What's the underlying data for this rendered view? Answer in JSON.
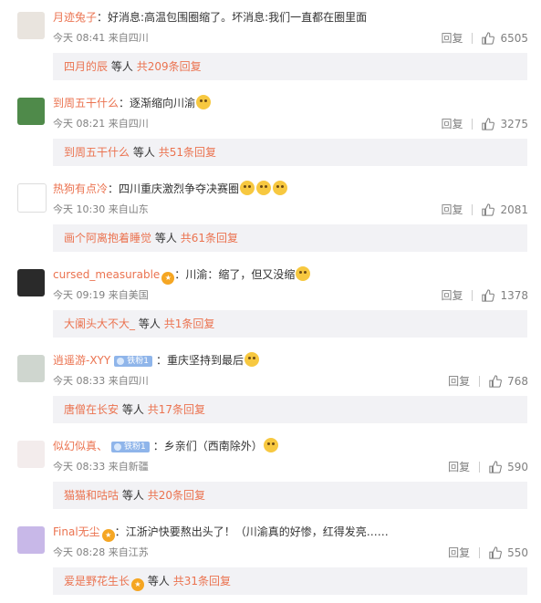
{
  "colors": {
    "username": "#eb7350",
    "link": "#eb7350",
    "meta": "#808080",
    "subbox_bg": "#f2f2f5",
    "badge": "#8fb5ea"
  },
  "labels": {
    "reply": "回复",
    "etc": "等人"
  },
  "comments": [
    {
      "username": "月迹兔子",
      "colon": "：",
      "text": "好消息:高温包围圈缩了。坏消息:我们一直都在圈里面",
      "emojis": [],
      "badge": "",
      "vip": false,
      "time": "今天 08:41",
      "location": "来自四川",
      "likes": "6505",
      "sub_user": "四月的辰",
      "sub_user_vip": false,
      "sub_count": "共209条回复"
    },
    {
      "username": "到周五干什么",
      "colon": "：",
      "text": "逐渐缩向川渝",
      "emojis": [
        "thinking-emoji"
      ],
      "badge": "",
      "vip": false,
      "time": "今天 08:21",
      "location": "来自四川",
      "likes": "3275",
      "sub_user": "到周五干什么",
      "sub_user_vip": false,
      "sub_count": "共51条回复"
    },
    {
      "username": "热狗有点冷",
      "colon": "：",
      "text": "四川重庆激烈争夺决赛圈",
      "emojis": [
        "laugh-cry-emoji",
        "laugh-cry-emoji",
        "laugh-cry-emoji"
      ],
      "badge": "",
      "vip": false,
      "time": "今天 10:30",
      "location": "来自山东",
      "likes": "2081",
      "sub_user": "画个阿离抱着睡觉",
      "sub_user_vip": false,
      "sub_count": "共61条回复"
    },
    {
      "username": "cursed_measurable",
      "colon": "：",
      "text": "川渝：缩了，但又没缩",
      "emojis": [
        "sweat-emoji"
      ],
      "badge": "",
      "vip": true,
      "time": "今天 09:19",
      "location": "来自美国",
      "likes": "1378",
      "sub_user": "大阑头大不大_",
      "sub_user_vip": false,
      "sub_count": "共1条回复"
    },
    {
      "username": "逍遥游-XYY",
      "colon": "：",
      "text": "重庆坚持到最后",
      "emojis": [
        "laugh-cry-emoji"
      ],
      "badge": "铁粉1",
      "vip": false,
      "time": "今天 08:33",
      "location": "来自四川",
      "likes": "768",
      "sub_user": "唐僧在长安",
      "sub_user_vip": false,
      "sub_count": "共17条回复"
    },
    {
      "username": "似幻似真、",
      "colon": "：",
      "text": "乡亲们（西南除外）",
      "emojis": [
        "doge-emoji"
      ],
      "badge": "铁粉1",
      "vip": false,
      "time": "今天 08:33",
      "location": "来自新疆",
      "likes": "590",
      "sub_user": "猫猫和咕咕",
      "sub_user_vip": false,
      "sub_count": "共20条回复"
    },
    {
      "username": "Final无尘",
      "colon": "：",
      "text": "江浙沪快要熬出头了！（川渝真的好惨，红得发亮……",
      "emojis": [],
      "badge": "",
      "vip": true,
      "time": "今天 08:28",
      "location": "来自江苏",
      "likes": "550",
      "sub_user": "爱是野花生长",
      "sub_user_vip": true,
      "sub_count": "共31条回复"
    }
  ]
}
